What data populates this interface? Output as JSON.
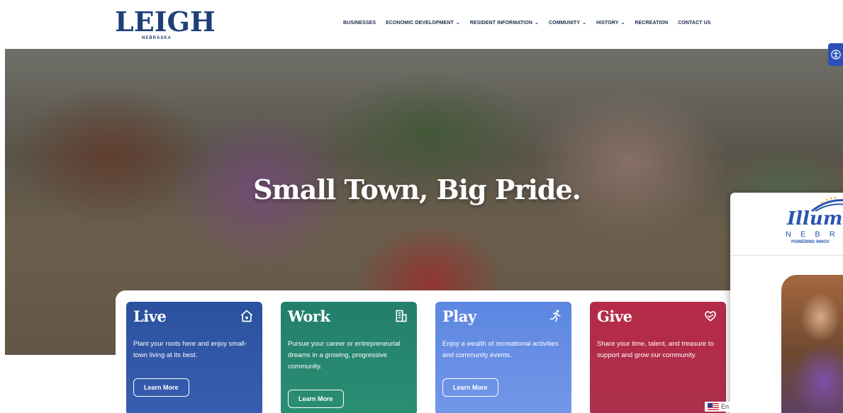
{
  "header": {
    "logo_text": "EIGH",
    "logo_initial": "L",
    "logo_sub": "NEBRASKA",
    "nav": [
      {
        "label": "BUSINESSES",
        "dropdown": false
      },
      {
        "label": "ECONOMIC DEVELOPMENT",
        "dropdown": true
      },
      {
        "label": "RESIDENT INFORMATION",
        "dropdown": true
      },
      {
        "label": "COMMUNITY",
        "dropdown": true
      },
      {
        "label": "HISTORY",
        "dropdown": true
      },
      {
        "label": "RECREATION",
        "dropdown": false
      },
      {
        "label": "CONTACT US",
        "dropdown": false
      }
    ],
    "chevron": "⌄"
  },
  "hero": {
    "title": "Small Town, Big Pride."
  },
  "cards": [
    {
      "title": "Live",
      "icon": "home-heart-icon",
      "text": "Plant your roots here and enjoy small-town living at its best.",
      "button": "Learn More",
      "color": "#1f4fa8"
    },
    {
      "title": "Work",
      "icon": "building-icon",
      "text": "Pursue your career or entrepreneurial dreams in a growing, progressive community.",
      "button": "Learn More",
      "color": "#127a64"
    },
    {
      "title": "Play",
      "icon": "running-person-icon",
      "text": "Enjoy a wealth of recreational activities and community events.",
      "button": "Learn More",
      "color": "#4e7fe0"
    },
    {
      "title": "Give",
      "icon": "hand-heart-icon",
      "text": "Share your time, talent, and treasure to support and grow our community.",
      "button": "Learn More",
      "color": "#b01e3c"
    }
  ],
  "popup": {
    "logo": "Illumin",
    "sub1": "N E B R A S",
    "sub2": "POWERING INNOV"
  },
  "language": {
    "label": "En"
  },
  "colors": {
    "brand_navy": "#1f3f78",
    "accessibility_blue": "#2c50b8"
  }
}
